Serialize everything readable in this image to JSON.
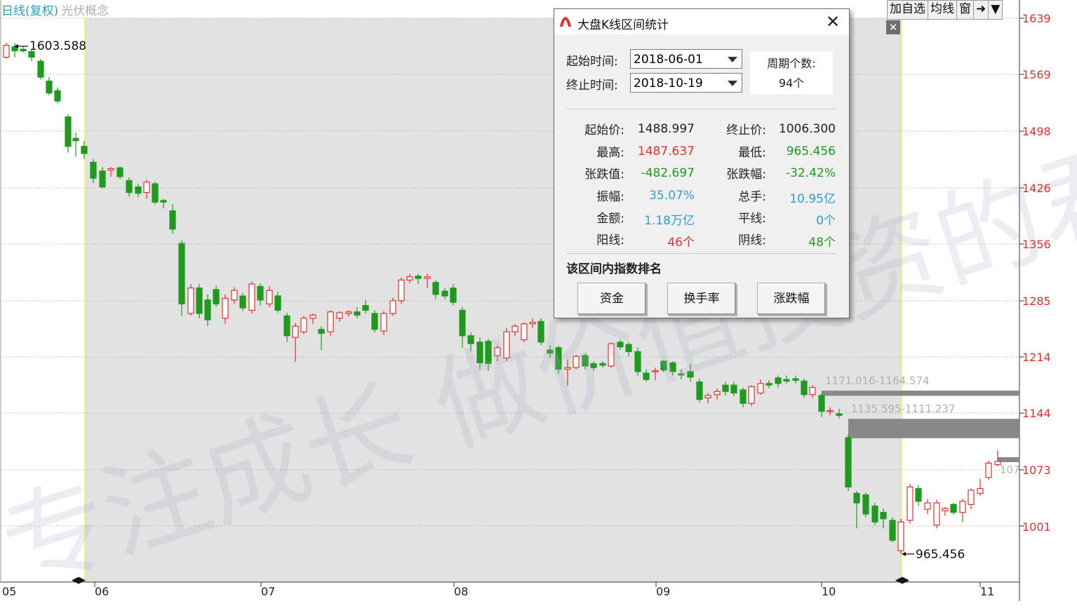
{
  "header": {
    "title": "日线(复权)",
    "subtitle": "光伏概念"
  },
  "toolbar": {
    "items": [
      "加自选",
      "均线",
      "窗",
      "➜",
      "▼"
    ]
  },
  "small_close": "✕",
  "chart_data": {
    "type": "candlestick",
    "y_ticks": [
      "1639",
      "1569",
      "1498",
      "1426",
      "1356",
      "1285",
      "1214",
      "1144",
      "1073",
      "1001"
    ],
    "x_ticks": [
      "05",
      "06",
      "07",
      "08",
      "09",
      "10",
      "11"
    ],
    "annotations": {
      "high": "1603.588",
      "low": "965.456",
      "right_cut": "107"
    },
    "zones": [
      {
        "label": "1171.016-1164.574",
        "top": 1171.016,
        "bottom": 1164.574
      },
      {
        "label": "1135.595-1111.237",
        "top": 1135.595,
        "bottom": 1111.237
      },
      {
        "label": "",
        "top": 1084,
        "bottom": 1078
      }
    ],
    "colors": {
      "up": "#e03030",
      "down": "#1f9a1f",
      "selection": "#e2e2e2",
      "axis_label": "#e03030"
    }
  },
  "watermark": "专注成长 做价值投资的君临",
  "dialog": {
    "title": "大盘K线区间统计",
    "close": "✕",
    "start_label": "起始时间:",
    "start_value": "2018-06-01",
    "end_label": "终止时间:",
    "end_value": "2018-10-19",
    "period_label": "周期个数:",
    "period_value": "94个",
    "stats": [
      {
        "label": "起始价:",
        "value": "1488.997",
        "color": "#222222"
      },
      {
        "label": "终止价:",
        "value": "1006.300",
        "color": "#222222"
      },
      {
        "label": "最高:",
        "value": "1487.637",
        "color": "#e03030"
      },
      {
        "label": "最低:",
        "value": "965.456",
        "color": "#1f9a1f"
      },
      {
        "label": "张跌值:",
        "value": "-482.697",
        "color": "#1f9a1f"
      },
      {
        "label": "张跌幅:",
        "value": "-32.42%",
        "color": "#1f9a1f"
      },
      {
        "label": "振幅:",
        "value": "35.07%",
        "color": "#2b9fd0"
      },
      {
        "label": "总手:",
        "value": "10.95亿",
        "color": "#2b9fd0"
      },
      {
        "label": "金额:",
        "value": "1.18万亿",
        "color": "#2b9fd0"
      },
      {
        "label": "平线:",
        "value": "0个",
        "color": "#2b9fd0"
      },
      {
        "label": "阳线:",
        "value": "46个",
        "color": "#e03030"
      },
      {
        "label": "阴线:",
        "value": "48个",
        "color": "#1f9a1f"
      }
    ],
    "section_title": "该区间内指数排名",
    "buttons": [
      "资金",
      "换手率",
      "涨跌幅"
    ]
  }
}
